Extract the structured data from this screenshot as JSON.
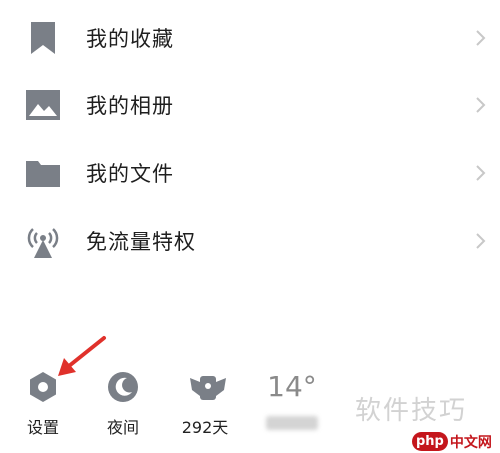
{
  "menu": {
    "items": [
      {
        "label": "我的收藏",
        "icon": "bookmark-icon"
      },
      {
        "label": "我的相册",
        "icon": "image-icon"
      },
      {
        "label": "我的文件",
        "icon": "folder-icon"
      },
      {
        "label": "免流量特权",
        "icon": "antenna-icon"
      }
    ]
  },
  "bottom_bar": {
    "settings_label": "设置",
    "night_label": "夜间",
    "days_label": "292天",
    "temperature": "14°"
  },
  "watermark": {
    "text": "软件技巧",
    "badge_php": "php",
    "badge_cn": "中文网"
  },
  "colors": {
    "icon_gray": "#7a7f87",
    "chevron": "#c8c8c8",
    "arrow": "#e0312b"
  }
}
